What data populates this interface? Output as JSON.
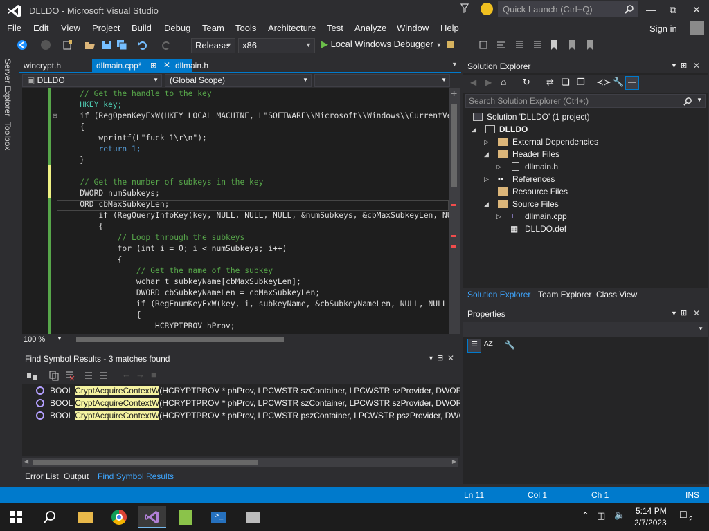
{
  "window": {
    "title": "DLLDO - Microsoft Visual Studio",
    "quick_launch_placeholder": "Quick Launch (Ctrl+Q)",
    "sign_in": "Sign in"
  },
  "menu": [
    "File",
    "Edit",
    "View",
    "Project",
    "Build",
    "Debug",
    "Team",
    "Tools",
    "Architecture",
    "Test",
    "Analyze",
    "Window",
    "Help"
  ],
  "toolbar": {
    "configuration": "Release",
    "platform": "x86",
    "debugger": "Local Windows Debugger"
  },
  "left_tabs": [
    "Server Explorer",
    "Toolbox"
  ],
  "doc_tabs": [
    {
      "label": "wincrypt.h"
    },
    {
      "label": "dllmain.cpp*"
    },
    {
      "label": "dllmain.h"
    }
  ],
  "navbar": {
    "project": "DLLDO",
    "scope": "(Global Scope)"
  },
  "code": [
    "    // Get the handle to the key",
    "    HKEY key;",
    "    if (RegOpenKeyExW(HKEY_LOCAL_MACHINE, L\"SOFTWARE\\\\Microsoft\\\\Windows\\\\CurrentVer",
    "    {",
    "        wprintf(L\"fuck 1\\r\\n\");",
    "        return 1;",
    "    }",
    "",
    "    // Get the number of subkeys in the key",
    "    DWORD numSubkeys;",
    "    ORD cbMaxSubkeyLen;",
    "        if (RegQueryInfoKey(key, NULL, NULL, NULL, &numSubkeys, &cbMaxSubkeyLen, NUL",
    "        {",
    "            // Loop through the subkeys",
    "            for (int i = 0; i < numSubkeys; i++)",
    "            {",
    "                // Get the name of the subkey",
    "                wchar_t subkeyName[cbMaxSubkeyLen];",
    "                DWORD cbSubkeyNameLen = cbMaxSubkeyLen;",
    "                if (RegEnumKeyExW(key, i, subkeyName, &cbSubkeyNameLen, NULL, NULL,",
    "                {",
    "                    HCRYPTPROV hProv;"
  ],
  "zoom": "100 %",
  "find_results": {
    "title": "Find Symbol Results - 3 matches found",
    "rows": [
      {
        "prefix": "BOOL ",
        "match": "CryptAcquireContextW",
        "rest": "(HCRYPTPROV * phProv, LPCWSTR szContainer, LPCWSTR szProvider, DWORD dwP"
      },
      {
        "prefix": "BOOL ",
        "match": "CryptAcquireContextW",
        "rest": "(HCRYPTPROV * phProv, LPCWSTR szContainer, LPCWSTR szProvider, DWORD dwP"
      },
      {
        "prefix": "BOOL ",
        "match": "CryptAcquireContextW",
        "rest": "(HCRYPTPROV * phProv, LPCWSTR pszContainer, LPCWSTR pszProvider, DWORD d"
      }
    ]
  },
  "bottom_tabs": [
    "Error List",
    "Output",
    "Find Symbol Results"
  ],
  "solution_explorer": {
    "title": "Solution Explorer",
    "search_placeholder": "Search Solution Explorer (Ctrl+;)",
    "tree": [
      {
        "label": "Solution 'DLLDO' (1 project)"
      },
      {
        "label": "DLLDO"
      },
      {
        "label": "External Dependencies"
      },
      {
        "label": "Header Files"
      },
      {
        "label": "dllmain.h"
      },
      {
        "label": "References"
      },
      {
        "label": "Resource Files"
      },
      {
        "label": "Source Files"
      },
      {
        "label": "dllmain.cpp"
      },
      {
        "label": "DLLDO.def"
      }
    ],
    "tabs": [
      "Solution Explorer",
      "Team Explorer",
      "Class View"
    ]
  },
  "properties": {
    "title": "Properties"
  },
  "status": {
    "line": "Ln 11",
    "col": "Col 1",
    "ch": "Ch 1",
    "mode": "INS"
  },
  "taskbar": {
    "time": "5:14 PM",
    "date": "2/7/2023",
    "notifications": "2"
  },
  "colors": {
    "accent": "#007acc",
    "editor_bg": "#1e1e1e",
    "highlight": "#f5f3a1"
  }
}
